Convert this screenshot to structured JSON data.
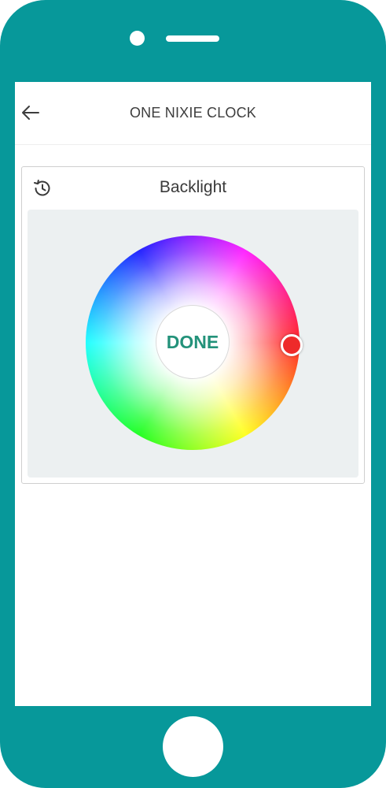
{
  "header": {
    "title": "ONE NIXIE CLOCK"
  },
  "widget": {
    "title": "Backlight",
    "done_label": "DONE",
    "selected_color": "#ee2a2a"
  },
  "icons": {
    "back": "arrow-left-icon",
    "history": "history-icon"
  },
  "colors": {
    "device_frame": "#07989a",
    "accent": "#23927a",
    "panel": "#ecf0f1"
  }
}
